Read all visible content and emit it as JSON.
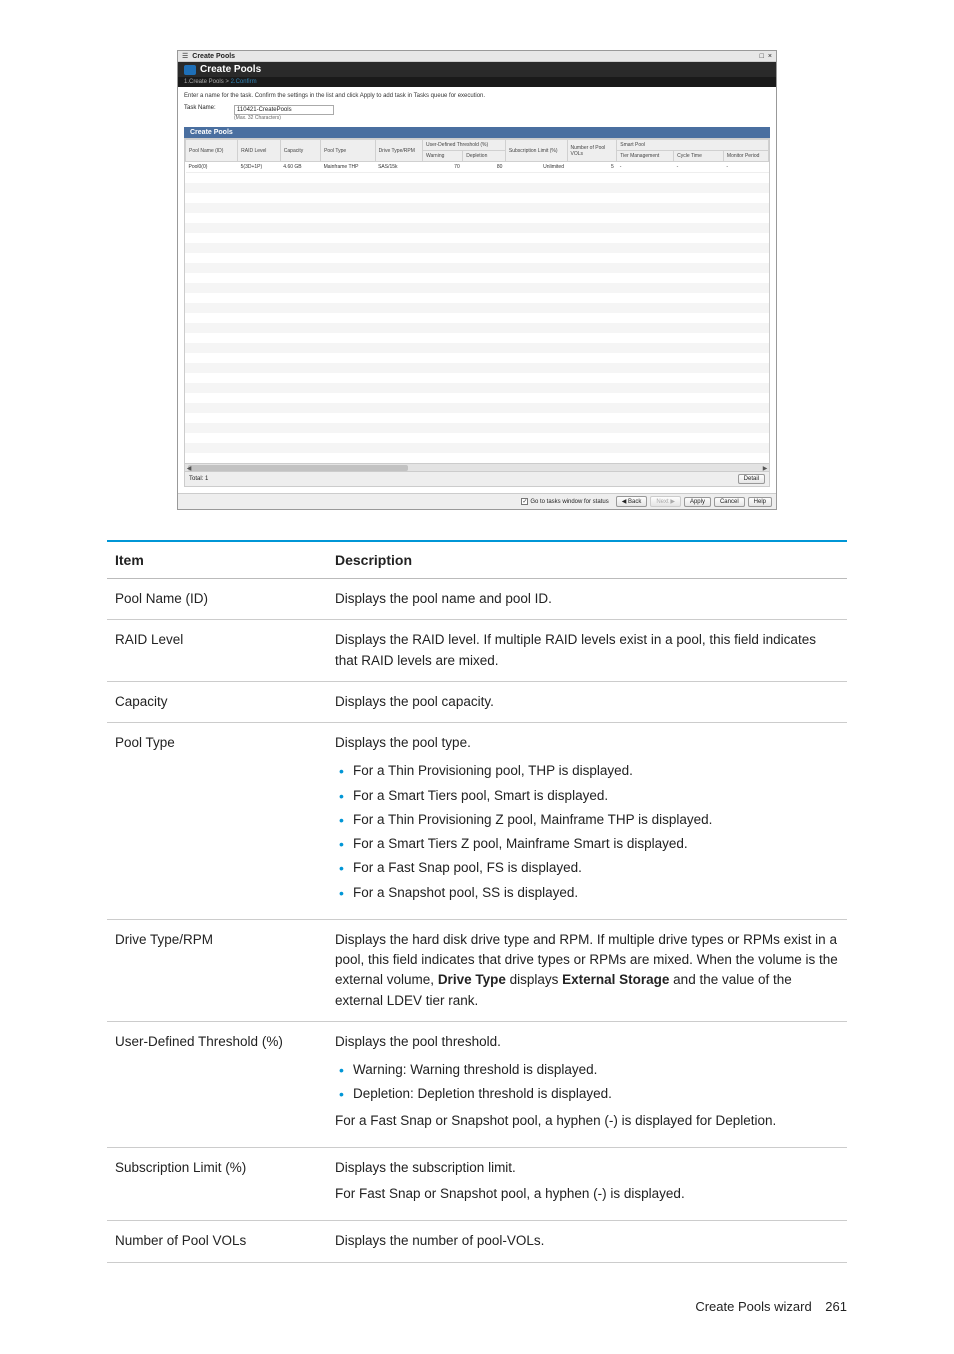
{
  "screenshot": {
    "titlebar_text": "Create Pools",
    "header_title": "Create Pools",
    "breadcrumb_step1": "1.Create Pools",
    "breadcrumb_sep": ">",
    "breadcrumb_step2": "2.Confirm",
    "instruction": "Enter a name for the task. Confirm the settings in the list and click Apply to add task in Tasks queue for execution.",
    "task_label": "Task Name:",
    "task_value": "110421-CreatePools",
    "task_hint": "(Max. 32 Characters)",
    "table_title": "Create Pools",
    "columns": {
      "pool_name": "Pool Name (ID)",
      "raid_level": "RAID Level",
      "capacity": "Capacity",
      "pool_type": "Pool Type",
      "drive_type": "Drive Type/RPM",
      "user_threshold_group": "User-Defined Threshold (%)",
      "warning": "Warning",
      "depletion": "Depletion",
      "sub_limit": "Subscription Limit (%)",
      "num_pool_vols": "Number of Pool VOLs",
      "smart_pool_group": "Smart Pool",
      "tier_mgmt": "Tier Management",
      "cycle_time": "Cycle Time",
      "monitor_period": "Monitor Period"
    },
    "data_row": {
      "pool_name": "Pool0(0)",
      "raid_level": "5(3D+1P)",
      "capacity": "4.60 GB",
      "pool_type": "Mainframe THP",
      "drive_type": "SAS/15k",
      "warning": "70",
      "depletion": "80",
      "sub_limit": "Unlimited",
      "num_pool_vols": "5",
      "tier_mgmt": "-",
      "cycle_time": "-",
      "monitor_period": "-"
    },
    "total_label": "Total: 1",
    "detail_btn": "Detail",
    "checkbox_label": "Go to tasks window for status",
    "buttons": {
      "back": "◀ Back",
      "next": "Next ▶",
      "apply": "Apply",
      "cancel": "Cancel",
      "help": "Help"
    },
    "title_icons": {
      "max": "□",
      "close": "×",
      "pin": "☰"
    }
  },
  "desc_table": {
    "header_item": "Item",
    "header_desc": "Description",
    "rows": [
      {
        "item": "Pool Name (ID)",
        "desc_plain": "Displays the pool name and pool ID."
      },
      {
        "item": "RAID Level",
        "desc_plain": "Displays the RAID level. If multiple RAID levels exist in a pool, this field indicates that RAID levels are mixed."
      },
      {
        "item": "Capacity",
        "desc_plain": "Displays the pool capacity."
      },
      {
        "item": "Pool Type",
        "desc_intro": "Displays the pool type.",
        "bullets": [
          "For a Thin Provisioning pool, THP is displayed.",
          "For a Smart Tiers pool, Smart is displayed.",
          "For a Thin Provisioning Z pool, Mainframe THP is displayed.",
          "For a Smart Tiers Z pool, Mainframe Smart is displayed.",
          "For a Fast Snap pool, FS is displayed.",
          "For a Snapshot pool, SS is displayed."
        ]
      },
      {
        "item": "Drive Type/RPM",
        "desc_rich": {
          "pre": "Displays the hard disk drive type and RPM. If multiple drive types or RPMs exist in a pool, this field indicates that drive types or RPMs are mixed. When the volume is the external volume, ",
          "b1": "Drive Type",
          "mid": " displays ",
          "b2": "External Storage",
          "post": " and the value of the external LDEV tier rank."
        }
      },
      {
        "item": "User-Defined Threshold (%)",
        "desc_intro": "Displays the pool threshold.",
        "bullets": [
          "Warning: Warning threshold is displayed.",
          "Depletion: Depletion threshold is displayed."
        ],
        "desc_outro": "For a Fast Snap or Snapshot pool, a hyphen (-) is displayed for Depletion."
      },
      {
        "item": "Subscription Limit (%)",
        "desc_intro": "Displays the subscription limit.",
        "desc_outro": "For Fast Snap or Snapshot pool, a hyphen (-) is displayed."
      },
      {
        "item": "Number of Pool VOLs",
        "desc_plain": "Displays the number of pool-VOLs."
      }
    ]
  },
  "footer": {
    "text": "Create Pools wizard",
    "page": "261"
  }
}
